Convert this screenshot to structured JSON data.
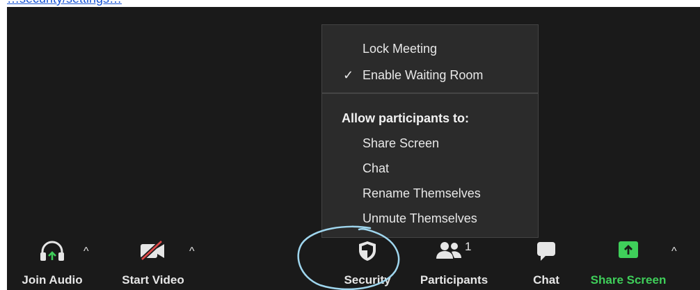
{
  "top_link": {
    "text": "…security/settings…"
  },
  "menu": {
    "lock_meeting": "Lock Meeting",
    "enable_waiting_room": "Enable Waiting Room",
    "checkmark": "✓",
    "heading": "Allow participants to:",
    "allow_items": [
      "Share Screen",
      "Chat",
      "Rename Themselves",
      "Unmute Themselves"
    ]
  },
  "toolbar": {
    "join_audio": "Join Audio",
    "start_video": "Start Video",
    "security": "Security",
    "participants": "Participants",
    "participants_count": "1",
    "chat": "Chat",
    "share_screen": "Share Screen",
    "caret": "^"
  },
  "colors": {
    "background": "#1a1a1a",
    "menu_bg": "#2b2b2b",
    "accent_green": "#3fcf5a",
    "annotation_circle": "#9fd6ee",
    "video_slash": "#e04848"
  },
  "icons": [
    "headphones-icon",
    "video-off-icon",
    "shield-icon",
    "participants-icon",
    "chat-bubble-icon",
    "share-screen-icon",
    "checkmark-icon",
    "caret-up-icon"
  ]
}
